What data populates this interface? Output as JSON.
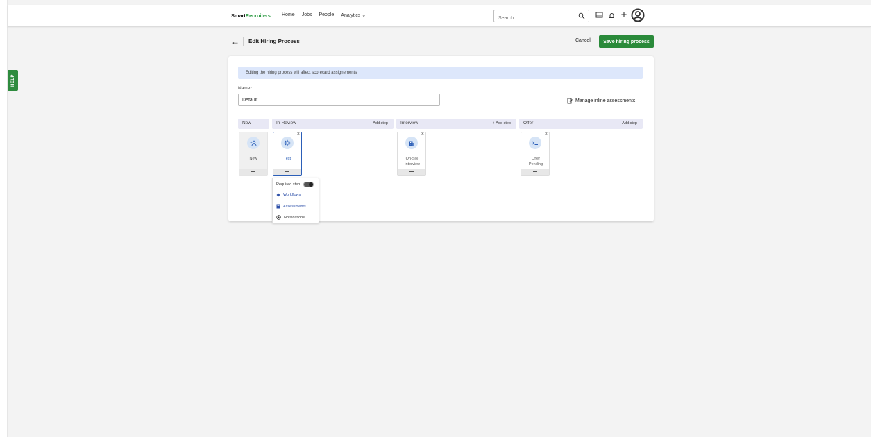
{
  "sidebar": {
    "help_label": "HELP"
  },
  "topbar": {
    "logo_dark": "Smart",
    "logo_green": "Recruiters",
    "nav": [
      "Home",
      "Jobs",
      "People",
      "Analytics ⌄"
    ],
    "search_placeholder": "Search"
  },
  "header": {
    "title": "Edit Hiring Process",
    "cancel_label": "Cancel",
    "save_label": "Save hiring process"
  },
  "form": {
    "banner": "Editing the hiring process will affect scorecard assignements",
    "name_label": "Name*",
    "name_value": "Default",
    "manage_label": "Manage inline assessments"
  },
  "columns": [
    {
      "title": "New",
      "add_label": ""
    },
    {
      "title": "In-Review",
      "add_label": "+ Add step"
    },
    {
      "title": "Interview",
      "add_label": "+ Add step"
    },
    {
      "title": "Offer",
      "add_label": "+ Add step"
    }
  ],
  "steps": [
    {
      "label": "New",
      "icon": "add-person-icon"
    },
    {
      "label": "Test",
      "icon": "gear-icon"
    },
    {
      "label": "On-Site Interview",
      "icon": "building-icon"
    },
    {
      "label": "Offer Pending",
      "icon": "document-pen-icon"
    }
  ],
  "step_close": "×",
  "popup": {
    "required_label": "Required step",
    "items": [
      "Workflows",
      "Assessments",
      "Notifications"
    ]
  },
  "colors": {
    "accent_green": "#2a8a3a",
    "link_blue": "#2c5fb8",
    "banner_bg": "#dde7fb"
  }
}
